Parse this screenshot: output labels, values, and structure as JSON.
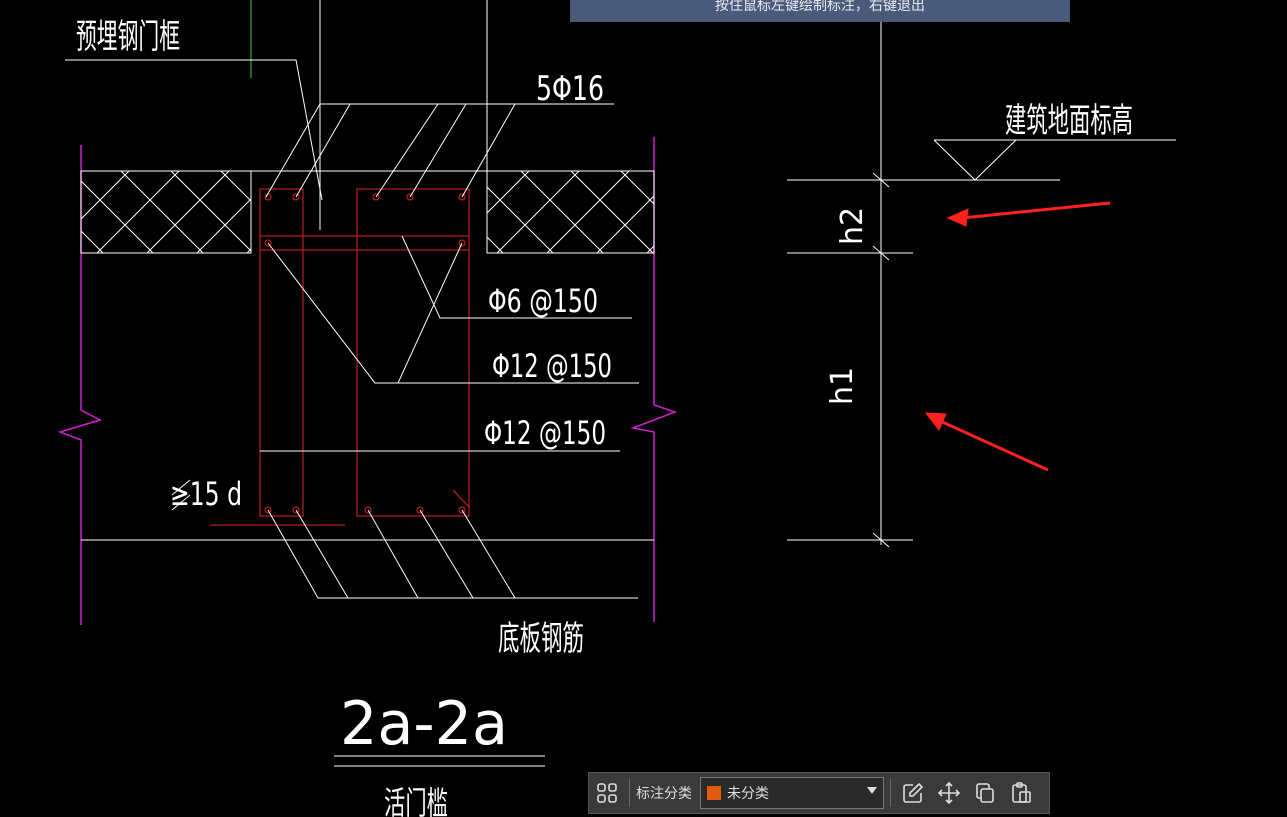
{
  "hint": {
    "text": "按住鼠标左键绘制标注，右键退出"
  },
  "drawing": {
    "label_embedded_frame": "预埋钢门框",
    "label_top_rebar": "5Φ16",
    "label_ground_elevation": "建筑地面标高",
    "label_h2": "h2",
    "label_h1": "h1",
    "label_stirrup": "Φ6 @150",
    "label_rebar_a": "Φ12 @150",
    "label_rebar_b": "Φ12 @150",
    "label_anchor": "≥15 d",
    "label_slab_rebar": "底板钢筋",
    "section_title": "2a-2a",
    "section_subtitle": "活门槛"
  },
  "toolbar": {
    "category_label": "标注分类",
    "category_value": "未分类",
    "category_color": "#e05a10"
  }
}
